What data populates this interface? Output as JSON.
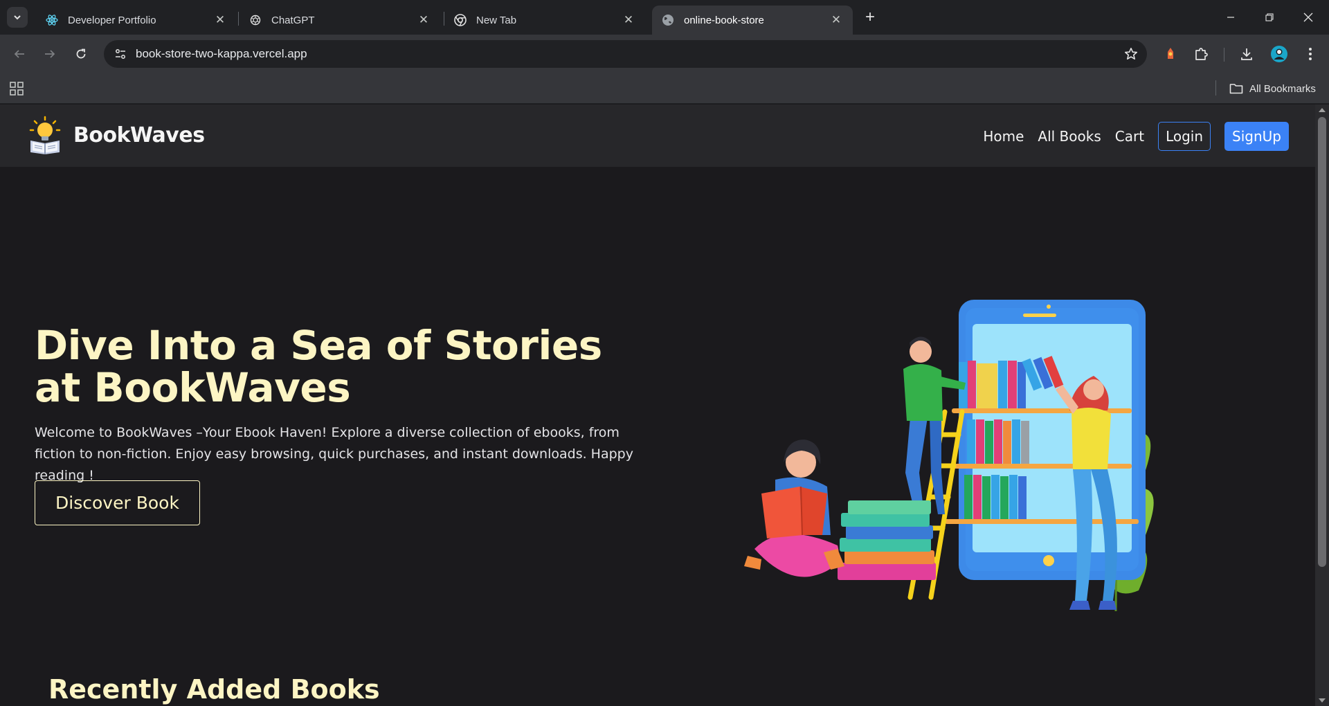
{
  "browser": {
    "tabs": [
      {
        "title": "Developer Portfolio",
        "icon": "react-icon",
        "active": false
      },
      {
        "title": "ChatGPT",
        "icon": "chatgpt-icon",
        "active": false
      },
      {
        "title": "New Tab",
        "icon": "chrome-icon",
        "active": false
      },
      {
        "title": "online-book-store",
        "icon": "globe-icon",
        "active": true
      }
    ],
    "url": "book-store-two-kappa.vercel.app",
    "bookmarks_label": "All Bookmarks"
  },
  "site": {
    "brand": "BookWaves",
    "nav": {
      "home": "Home",
      "all_books": "All Books",
      "cart": "Cart",
      "login": "Login",
      "signup": "SignUp"
    },
    "hero": {
      "title": "Dive Into a Sea of Stories at BookWaves",
      "description": "Welcome to BookWaves –Your Ebook Haven! Explore a diverse collection of ebooks, from fiction to non-fiction. Enjoy easy browsing, quick purchases, and instant downloads. Happy reading !",
      "cta": "Discover Book"
    },
    "recent_section_title": "Recently Added Books"
  },
  "colors": {
    "accent_blue": "#3b82f6",
    "hero_text": "#fdf5c4",
    "page_bg": "#1b1a1d",
    "nav_bg": "#27272a"
  }
}
